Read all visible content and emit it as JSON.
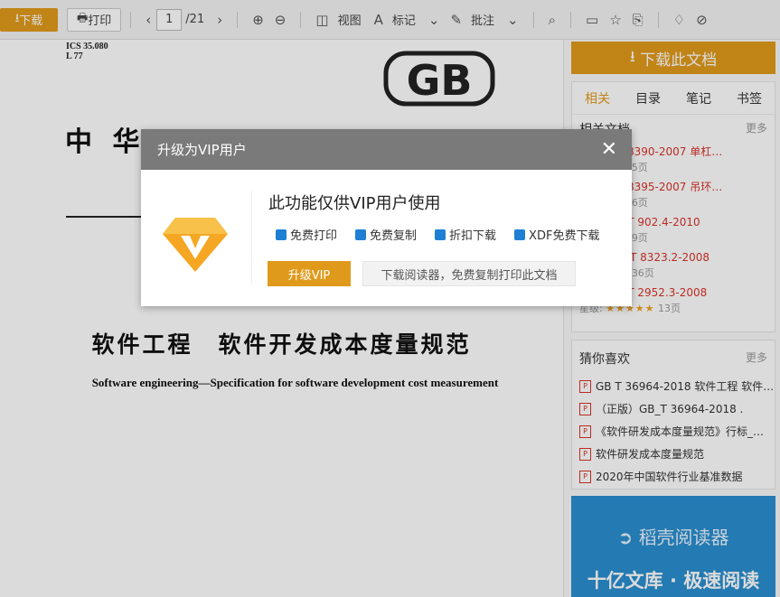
{
  "toolbar": {
    "download": "下载",
    "print": "打印",
    "page_current": "1",
    "page_total": "/21",
    "view": "视图",
    "mark": "标记",
    "annotate": "批注"
  },
  "doc": {
    "ics": "ICS 35.080",
    "code": "L 77",
    "logo_text": "GB",
    "header_cn": "中 华",
    "title": "软件工程　软件开发成本度量规范",
    "subtitle": "Software engineering—Specification for software development cost measurement"
  },
  "sidebar": {
    "download_btn": "下载此文档",
    "tabs": [
      "相关",
      "目录",
      "笔记",
      "书签"
    ],
    "related_head": "相关文档",
    "more": "更多",
    "related": [
      {
        "title": "版) GB T 8390-2007 单杠…",
        "pages": "5页",
        "stars": "★★★★★"
      },
      {
        "title": "版) GB T 8395-2007 吊环…",
        "pages": "6页",
        "stars": "★★★★★"
      },
      {
        "title": "正版) GB-T 902.4-2010",
        "pages": "9页",
        "stars": "★★★★★"
      },
      {
        "title": "正版) GB_T 8323.2-2008",
        "pages": "36页",
        "stars": "★★★★★"
      },
      {
        "title": "正版) GB-T 2952.3-2008",
        "pages": "13页",
        "stars": "★★★★★",
        "rating_label": "星级:"
      }
    ],
    "guess_head": "猜你喜欢",
    "guess": [
      "GB T 36964-2018 软件工程 软件…",
      "（正版）GB_T 36964-2018 .",
      "《软件研发成本度量规范》行标_…",
      "软件研发成本度量规范",
      "2020年中国软件行业基准数据"
    ],
    "ad_logo": "稻壳阅读器",
    "ad_slogan": "十亿文库 · 极速阅读"
  },
  "modal": {
    "header": "升级为VIP用户",
    "title": "此功能仅供VIP用户使用",
    "features": [
      "免费打印",
      "免费复制",
      "折扣下载",
      "XDF免费下载"
    ],
    "btn_vip": "升级VIP",
    "btn_reader": "下载阅读器，免费复制打印此文档"
  },
  "colors": {
    "accent": "#e09a1b",
    "link_red": "#d9342b",
    "modal_head": "#7a7a7a"
  }
}
